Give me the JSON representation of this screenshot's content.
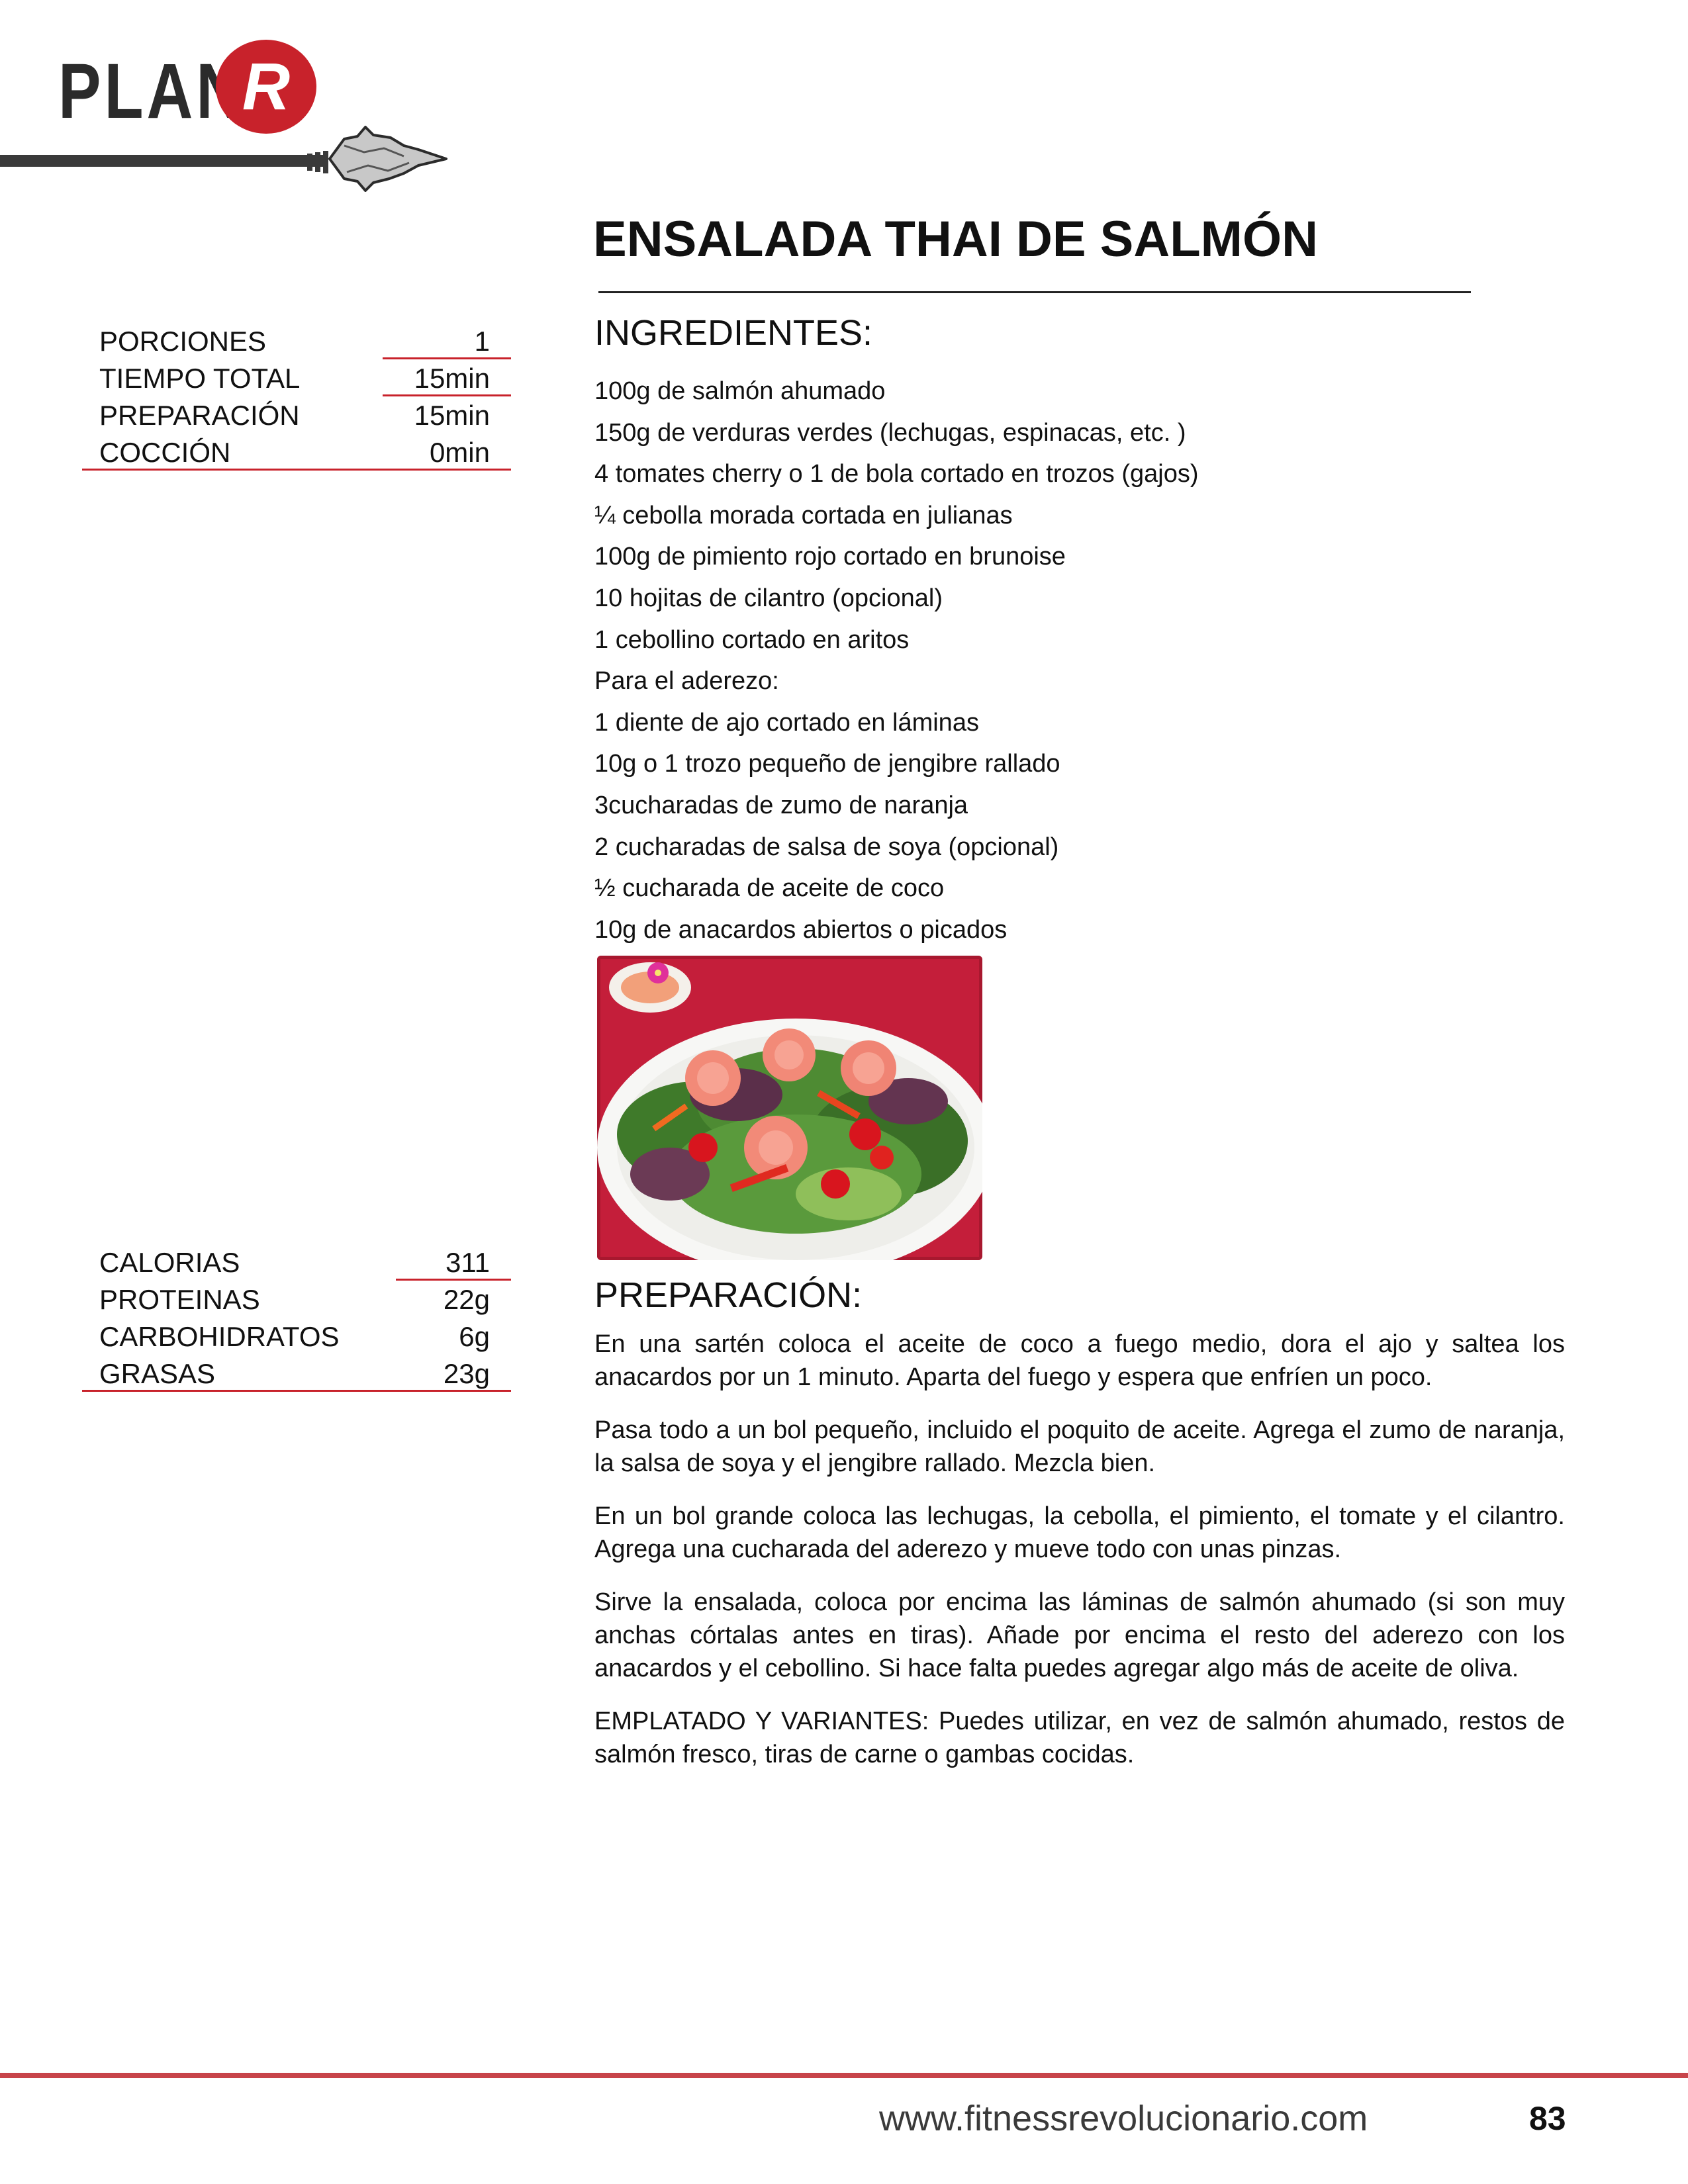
{
  "logo": {
    "word": "PLAN",
    "letter": "R"
  },
  "title": "ENSALADA THAI DE SALMÓN",
  "meta": [
    {
      "label": "PORCIONES",
      "value": "1"
    },
    {
      "label": "TIEMPO TOTAL",
      "value": "15min"
    },
    {
      "label": "PREPARACIÓN",
      "value": "15min"
    },
    {
      "label": "COCCIÓN",
      "value": "0min"
    }
  ],
  "nutrition": [
    {
      "label": "CALORIAS",
      "value": "311"
    },
    {
      "label": "PROTEINAS",
      "value": "22g"
    },
    {
      "label": "CARBOHIDRATOS",
      "value": "6g"
    },
    {
      "label": "GRASAS",
      "value": "23g"
    }
  ],
  "ingredients_heading": "INGREDIENTES:",
  "ingredients": [
    "100g de salmón ahumado",
    "150g de verduras verdes (lechugas, espinacas, etc. )",
    "4 tomates cherry o 1 de bola cortado en trozos (gajos)",
    "¼ cebolla morada cortada en julianas",
    "100g de pimiento rojo cortado en brunoise",
    "10 hojitas de cilantro (opcional)",
    "1 cebollino cortado en aritos",
    "Para el aderezo:",
    "1 diente de ajo cortado en láminas",
    "10g o 1 trozo pequeño de jengibre rallado",
    "3cucharadas de zumo de naranja",
    "2 cucharadas de salsa de soya (opcional)",
    "½ cucharada de aceite de coco",
    "10g de anacardos abiertos o picados"
  ],
  "preparation_heading": "PREPARACIÓN:",
  "preparation": [
    "En una sartén coloca el aceite de coco a fuego medio, dora el ajo y saltea  los anacardos por un 1 minuto. Aparta del fuego y espera que enfríen un poco.",
    "Pasa todo a un bol pequeño, incluido el poquito de aceite. Agrega el zumo de naranja, la salsa de soya y el jengibre rallado. Mezcla bien.",
    "En un bol grande coloca las lechugas, la cebolla, el pimiento, el tomate y el cilantro. Agrega una cucharada del aderezo y mueve todo con unas pinzas.",
    "Sirve la ensalada, coloca por encima las láminas de salmón ahumado (si son muy anchas córtalas antes en tiras). Añade por encima el resto del aderezo con los anacardos y el cebollino. Si hace falta puedes agregar algo más de aceite de oliva.",
    "EMPLATADO Y VARIANTES: Puedes utilizar, en vez de salmón ahumado, restos de salmón fresco, tiras de carne o gambas cocidas."
  ],
  "footer": {
    "url": "www.fitnessrevolucionario.com",
    "page": "83"
  },
  "colors": {
    "accent": "#c8222b",
    "text": "#111111",
    "footer_rule": "#c8444a"
  }
}
